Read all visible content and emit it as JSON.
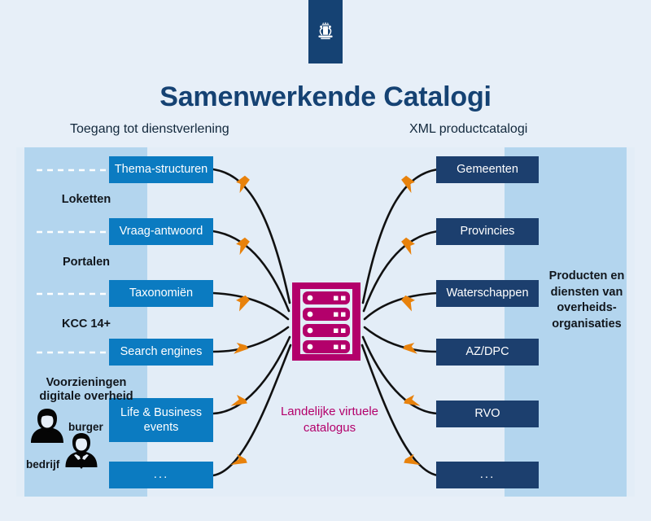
{
  "logo": {
    "name": "dutch-government-coat-of-arms",
    "color": "#154273"
  },
  "header": {
    "title": "Samenwerkende Catalogi",
    "subtitle_left": "Toegang tot dienstverlening",
    "subtitle_right": "XML productcatalogi"
  },
  "colors": {
    "page_background": "#e7eff8",
    "panel": "#e3edf7",
    "band": "#b3d5ee",
    "box_left": "#0b7bc1",
    "box_right": "#1c3f6e",
    "center": "#b3006b",
    "arrow": "#e8820c",
    "line": "#111111",
    "title": "#154273"
  },
  "left_column": {
    "boxes": [
      {
        "label": "Thema-structuren"
      },
      {
        "label": "Vraag-antwoord"
      },
      {
        "label": "Taxonomiën"
      },
      {
        "label": "Search engines"
      },
      {
        "label": "Life  & Business events"
      },
      {
        "label": "..."
      }
    ],
    "group_labels": [
      {
        "label": "Loketten"
      },
      {
        "label": "Portalen"
      },
      {
        "label": "KCC 14+"
      },
      {
        "label": "Voorzieningen digitale overheid"
      }
    ],
    "actors": [
      {
        "label": "burger",
        "icon": "female-person-icon"
      },
      {
        "label": "bedrijf",
        "icon": "male-businessperson-icon"
      }
    ]
  },
  "center": {
    "icon": "server-rack-icon",
    "label": "Landelijke virtuele catalogus"
  },
  "right_column": {
    "boxes": [
      {
        "label": "Gemeenten"
      },
      {
        "label": "Provincies"
      },
      {
        "label": "Waterschappen"
      },
      {
        "label": "AZ/DPC"
      },
      {
        "label": "RVO"
      },
      {
        "label": "..."
      }
    ],
    "note": "Producten en diensten van overheids- organisaties"
  }
}
